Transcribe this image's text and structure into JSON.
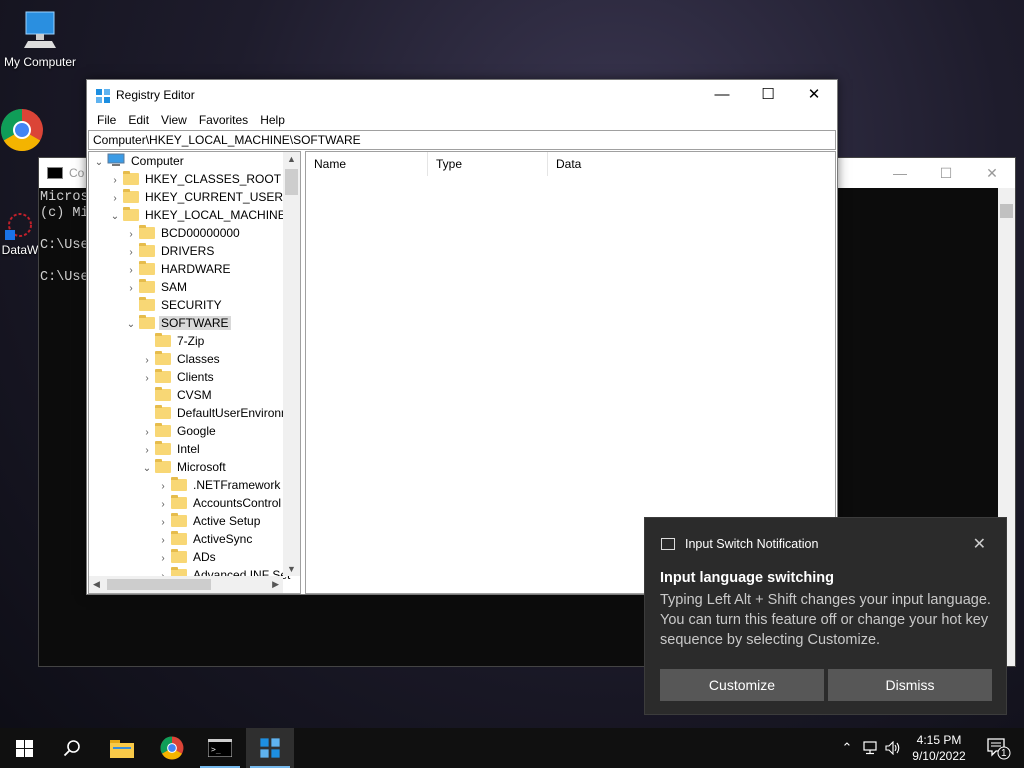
{
  "desktop": {
    "icons": [
      {
        "label": "My Computer"
      },
      {
        "label": "Goo\nChro"
      },
      {
        "label": "DataW"
      }
    ]
  },
  "console": {
    "title": "Co",
    "lines": [
      "Micros",
      "(c) Mi",
      "",
      "C:\\Use",
      "",
      "C:\\Use"
    ],
    "minimize": "—",
    "maximize": "☐",
    "close": "✕"
  },
  "regedit": {
    "title": "Registry Editor",
    "minimize": "—",
    "maximize": "☐",
    "close": "✕",
    "menu": [
      "File",
      "Edit",
      "View",
      "Favorites",
      "Help"
    ],
    "address": "Computer\\HKEY_LOCAL_MACHINE\\SOFTWARE",
    "tree": [
      {
        "label": "Computer",
        "chev": "v"
      },
      {
        "label": "HKEY_CLASSES_ROOT",
        "chev": ">"
      },
      {
        "label": "HKEY_CURRENT_USER",
        "chev": ">"
      },
      {
        "label": "HKEY_LOCAL_MACHINE",
        "chev": "v"
      },
      {
        "label": "BCD00000000",
        "chev": ">"
      },
      {
        "label": "DRIVERS",
        "chev": ">"
      },
      {
        "label": "HARDWARE",
        "chev": ">"
      },
      {
        "label": "SAM",
        "chev": ">"
      },
      {
        "label": "SECURITY",
        "chev": ""
      },
      {
        "label": "SOFTWARE",
        "chev": "v",
        "selected": true
      },
      {
        "label": "7-Zip",
        "chev": ""
      },
      {
        "label": "Classes",
        "chev": ">"
      },
      {
        "label": "Clients",
        "chev": ">"
      },
      {
        "label": "CVSM",
        "chev": ""
      },
      {
        "label": "DefaultUserEnvironn",
        "chev": ""
      },
      {
        "label": "Google",
        "chev": ">"
      },
      {
        "label": "Intel",
        "chev": ">"
      },
      {
        "label": "Microsoft",
        "chev": "v"
      },
      {
        "label": ".NETFramework",
        "chev": ">"
      },
      {
        "label": "AccountsControl",
        "chev": ">"
      },
      {
        "label": "Active Setup",
        "chev": ">"
      },
      {
        "label": "ActiveSync",
        "chev": ">"
      },
      {
        "label": "ADs",
        "chev": ">"
      },
      {
        "label": "Advanced INF Set",
        "chev": ">"
      }
    ],
    "columns": [
      "Name",
      "Type",
      "Data"
    ]
  },
  "toast": {
    "app_name": "Input Switch Notification",
    "close": "✕",
    "heading": "Input language switching",
    "body": "Typing Left Alt + Shift changes your input language. You can turn this feature off or change your hot key sequence by selecting Customize.",
    "customize": "Customize",
    "dismiss": "Dismiss"
  },
  "taskbar": {
    "time": "4:15 PM",
    "date": "9/10/2022",
    "notification_count": "1",
    "accent": "#76b9ed"
  }
}
